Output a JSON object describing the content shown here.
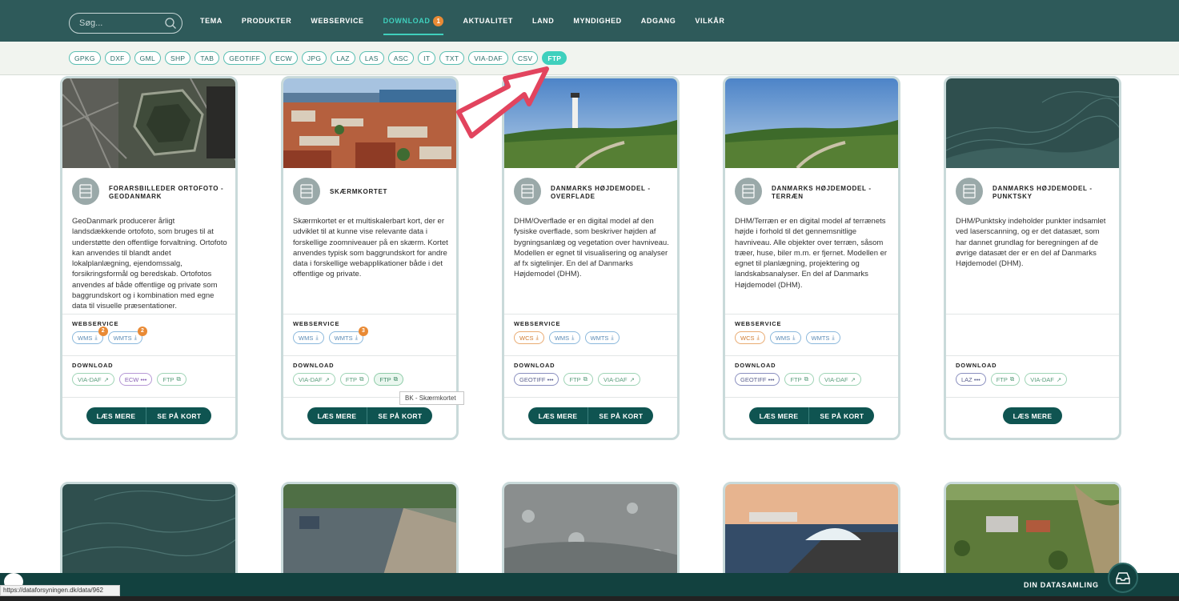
{
  "nav": {
    "search_placeholder": "Søg...",
    "links": [
      {
        "label": "TEMA"
      },
      {
        "label": "PRODUKTER"
      },
      {
        "label": "WEBSERVICE"
      },
      {
        "label": "DOWNLOAD",
        "badge": "1"
      },
      {
        "label": "AKTUALITET"
      },
      {
        "label": "LAND"
      },
      {
        "label": "MYNDIGHED"
      },
      {
        "label": "ADGANG"
      },
      {
        "label": "VILKÅR"
      }
    ]
  },
  "formats": [
    "GPKG",
    "DXF",
    "GML",
    "SHP",
    "TAB",
    "GEOTIFF",
    "ECW",
    "JPG",
    "LAZ",
    "LAS",
    "ASC",
    "IT",
    "TXT",
    "VIA-DAF",
    "CSV",
    "FTP"
  ],
  "section_labels": {
    "webservice": "WEBSERVICE",
    "download": "DOWNLOAD"
  },
  "buttons": {
    "read_more": "LÆS MERE",
    "see_map": "SE PÅ KORT"
  },
  "cards": [
    {
      "title": "FORARSBILLEDER ORTOFOTO - GEODANMARK",
      "desc": "GeoDanmark producerer årligt landsdækkende ortofoto, som bruges til at understøtte den offentlige forvaltning. Ortofoto kan anvendes til blandt andet lokalplanlægning, ejendomssalg, forsikringsformål og beredskab. Ortofotos anvendes af både offentlige og private som baggrundskort og i kombination med egne data til visuelle præsentationer.",
      "ws": [
        {
          "label": "WMS",
          "badge": "2"
        },
        {
          "label": "WMTS",
          "badge": "2"
        }
      ],
      "dl": [
        {
          "label": "VIA-DAF"
        },
        {
          "label": "ECW •••"
        },
        {
          "label": "FTP"
        }
      ]
    },
    {
      "title": "SKÆRMKORTET",
      "desc": "Skærmkortet er et multiskalerbart kort, der er udviklet til at kunne vise relevante data i forskellige zoomniveauer på en skærm. Kortet anvendes typisk som baggrundskort for andre data i forskellige webapplikationer både i det offentlige og private.",
      "ws": [
        {
          "label": "WMS"
        },
        {
          "label": "WMTS",
          "badge": "3"
        }
      ],
      "dl": [
        {
          "label": "VIA-DAF"
        },
        {
          "label": "FTP"
        },
        {
          "label": "FTP"
        }
      ]
    },
    {
      "title": "DANMARKS HØJDEMODEL - OVERFLADE",
      "desc": "DHM/Overflade er en digital model af den fysiske overflade, som beskriver højden af bygningsanlæg og vegetation over havniveau. Modellen er egnet til visualisering og analyser af fx sigtelinjer. En del af Danmarks Højdemodel (DHM).",
      "ws": [
        {
          "label": "WCS"
        },
        {
          "label": "WMS"
        },
        {
          "label": "WMTS"
        }
      ],
      "dl": [
        {
          "label": "GEOTIFF •••"
        },
        {
          "label": "FTP"
        },
        {
          "label": "VIA-DAF"
        }
      ]
    },
    {
      "title": "DANMARKS HØJDEMODEL - TERRÆN",
      "desc": "DHM/Terræn er en digital model af terrænets højde i forhold til det gennemsnitlige havniveau. Alle objekter over terræn, såsom træer, huse, biler m.m. er fjernet. Modellen er egnet til planlægning, projektering og landskabsanalyser. En del af Danmarks Højdemodel (DHM).",
      "ws": [
        {
          "label": "WCS"
        },
        {
          "label": "WMS"
        },
        {
          "label": "WMTS"
        }
      ],
      "dl": [
        {
          "label": "GEOTIFF •••"
        },
        {
          "label": "FTP"
        },
        {
          "label": "VIA-DAF"
        }
      ]
    },
    {
      "title": "DANMARKS HØJDEMODEL - PUNKTSKY",
      "desc": "DHM/Punktsky indeholder punkter indsamlet ved laserscanning, og er det datasæt, som har dannet grundlag for beregningen af de øvrige datasæt der er en del af Danmarks Højdemodel (DHM).",
      "dl": [
        {
          "label": "LAZ •••"
        },
        {
          "label": "FTP"
        },
        {
          "label": "VIA-DAF"
        }
      ]
    }
  ],
  "tooltip": "BK - Skærmkortet",
  "bottom": {
    "collection": "DIN DATASAMLING",
    "status_url": "https://dataforsyningen.dk/data/962"
  }
}
